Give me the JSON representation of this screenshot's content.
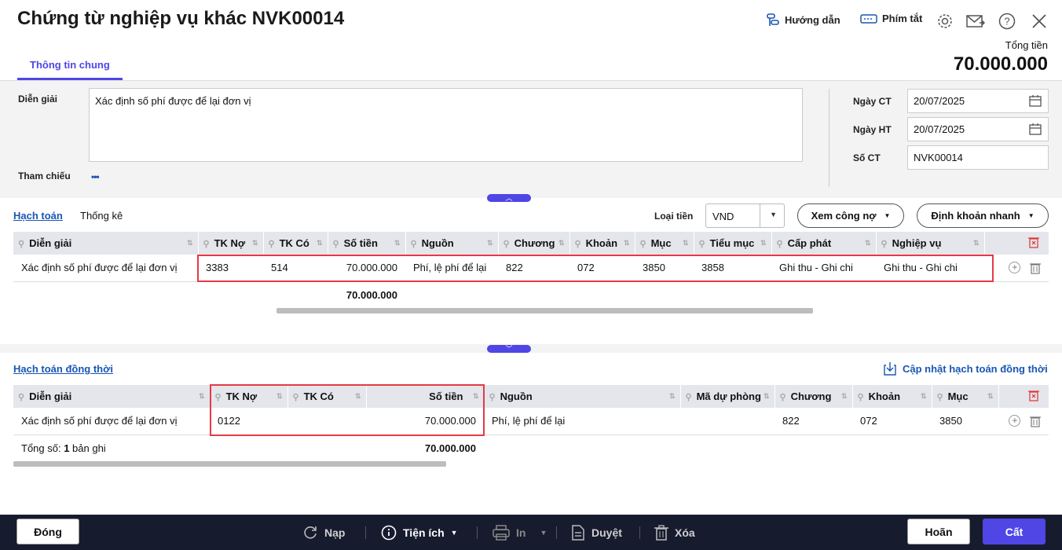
{
  "header": {
    "title": "Chứng từ nghiệp vụ khác NVK00014",
    "guide_label": "Hướng dẫn",
    "shortcut_label": "Phím tắt",
    "total_label": "Tổng tiền",
    "total_value": "70.000.000"
  },
  "tabs": [
    {
      "label": "Thông tin chung"
    }
  ],
  "form": {
    "description_label": "Diễn giải",
    "description_value": "Xác định số phí được để lại đơn vị",
    "reference_label": "Tham chiếu",
    "reference_dots": "•••",
    "doc_date_label": "Ngày CT",
    "doc_date_value": "20/07/2025",
    "post_date_label": "Ngày HT",
    "post_date_value": "20/07/2025",
    "doc_no_label": "Số CT",
    "doc_no_value": "NVK00014"
  },
  "section1": {
    "tab_accounting": "Hạch toán",
    "tab_stats": "Thống kê",
    "currency_label": "Loại tiền",
    "currency_value": "VND",
    "debt_button": "Xem công nợ",
    "quick_entry_button": "Định khoản nhanh",
    "columns": [
      "Diễn giải",
      "TK Nợ",
      "TK Có",
      "Số tiền",
      "Nguồn",
      "Chương",
      "Khoản",
      "Mục",
      "Tiểu mục",
      "Cấp phát",
      "Nghiệp vụ"
    ],
    "rows": [
      [
        "Xác định số phí được để lại đơn vị",
        "3383",
        "514",
        "70.000.000",
        "Phí, lệ phí để lại",
        "822",
        "072",
        "3850",
        "3858",
        "Ghi thu - Ghi chi",
        "Ghi thu - Ghi chi"
      ]
    ],
    "total_amount": "70.000.000"
  },
  "section2": {
    "title": "Hạch toán đồng thời",
    "update_link": "Cập nhật hạch toán đồng thời",
    "columns": [
      "Diễn giải",
      "TK Nợ",
      "TK Có",
      "Số tiền",
      "Nguồn",
      "Mã dự phòng",
      "Chương",
      "Khoản",
      "Mục"
    ],
    "rows": [
      [
        "Xác định số phí được để lại đơn vị",
        "0122",
        "",
        "70.000.000",
        "Phí, lệ phí để lại",
        "",
        "822",
        "072",
        "3850"
      ]
    ],
    "total_prefix": "Tổng số: ",
    "total_count": "1",
    "total_suffix": " bản ghi",
    "total_amount": "70.000.000"
  },
  "footer": {
    "close": "Đóng",
    "reload": "Nạp",
    "utilities": "Tiện ích",
    "print": "In",
    "approve": "Duyệt",
    "delete": "Xóa",
    "cancel": "Hoãn",
    "save": "Cất"
  },
  "colors": {
    "accent": "#4f46e5",
    "highlight": "#e63946",
    "footer_bg": "#171b2e",
    "link": "#1a56b4"
  }
}
